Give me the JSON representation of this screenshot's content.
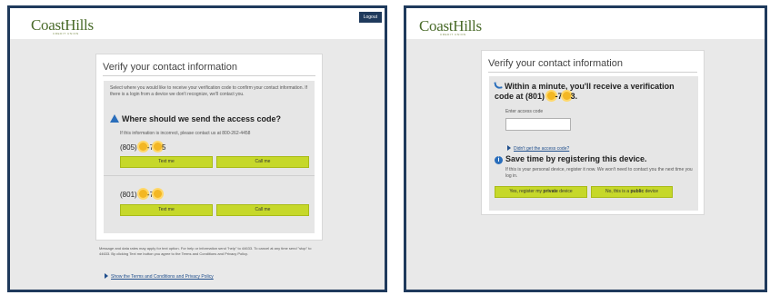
{
  "left": {
    "logo": "CoastHills",
    "logo_sub": "CREDIT UNION",
    "logout": "Logout",
    "card_title": "Verify your contact information",
    "intro": "Select where you would like to receive your verification code to confirm your contact information. If there is a login from a device we don't recognize, we'll contact you.",
    "heading": "Where should we send the access code?",
    "incorrect": "If this information is incorrect, please contact us at 800-262-4458",
    "phone1": "(805)",
    "phone1_mid": "-7",
    "phone1_end": "5",
    "phone2": "(801)",
    "phone2_mid": "-7",
    "text_me": "Text me",
    "call_me": "Call me",
    "footer_text": "Message and data rates may apply for text option. For help or information send \"help\" to 44633. To cancel at any time send \"stop\" to 44633. By clicking Text me button you agree to the Terms and Conditions and Privacy Policy.",
    "terms_link": "Show the Terms and Conditions and Privacy Policy"
  },
  "right": {
    "logo": "CoastHills",
    "logo_sub": "CREDIT UNION",
    "card_title": "Verify your contact information",
    "heading": "Within a minute, you'll receive a verification code at",
    "phone": "(801)",
    "phone_mid": "-7",
    "phone_end": "3.",
    "enter_label": "Enter access code",
    "didnt_get": "Didn't get the access code?",
    "save_heading": "Save time by registering this device.",
    "save_text": "If this is your personal device, register it now. We won't need to contact you the next time you log in.",
    "btn_yes_prefix": "Yes, register my ",
    "btn_yes_bold": "private",
    "btn_yes_suffix": " device",
    "btn_no_prefix": "No, this is a ",
    "btn_no_bold": "public",
    "btn_no_suffix": " device"
  },
  "colors": {
    "frame": "#1f3a5c",
    "button_green": "#c6d82a",
    "logo_green": "#4a6b2a",
    "accent_blue": "#2a6ebb"
  }
}
